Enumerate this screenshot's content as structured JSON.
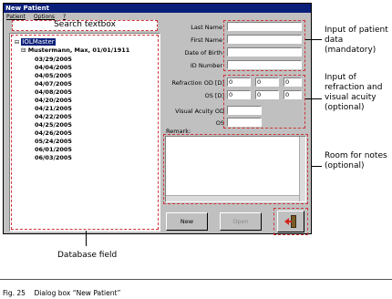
{
  "window": {
    "title": "New Patient",
    "menu": [
      "Patient",
      "Options",
      "?"
    ]
  },
  "search": {
    "label": "Search textbox"
  },
  "tree": {
    "root": "IOLMaster",
    "patient": "Mustermann, Max, 01/01/1911",
    "dates": [
      "03/29/2005",
      "04/04/2005",
      "04/05/2005",
      "04/07/2005",
      "04/08/2005",
      "04/20/2005",
      "04/21/2005",
      "04/22/2005",
      "04/25/2005",
      "04/26/2005",
      "05/24/2005",
      "06/01/2005",
      "06/03/2005"
    ]
  },
  "form": {
    "last_name": "Last Name",
    "first_name": "First Name",
    "dob": "Date of Birth",
    "id_number": "ID Number",
    "refraction_od": "Refraction OD [D]",
    "os_d": "OS [D]",
    "va_od": "Visual Acuity OD",
    "va_os": "OS",
    "remark": "Remark:",
    "ref_values": [
      "0",
      "0",
      "0"
    ],
    "os_values": [
      "0",
      "0",
      "0"
    ]
  },
  "buttons": {
    "new": "New",
    "open": "Open"
  },
  "annotations": {
    "patient_data": "Input of patient data (mandatory)",
    "refraction": "Input of refraction and visual acuity (optional)",
    "notes": "Room for notes (optional)",
    "database": "Database field"
  },
  "caption": {
    "fig": "Fig. 25",
    "text": "Dialog box “New Patient”"
  }
}
